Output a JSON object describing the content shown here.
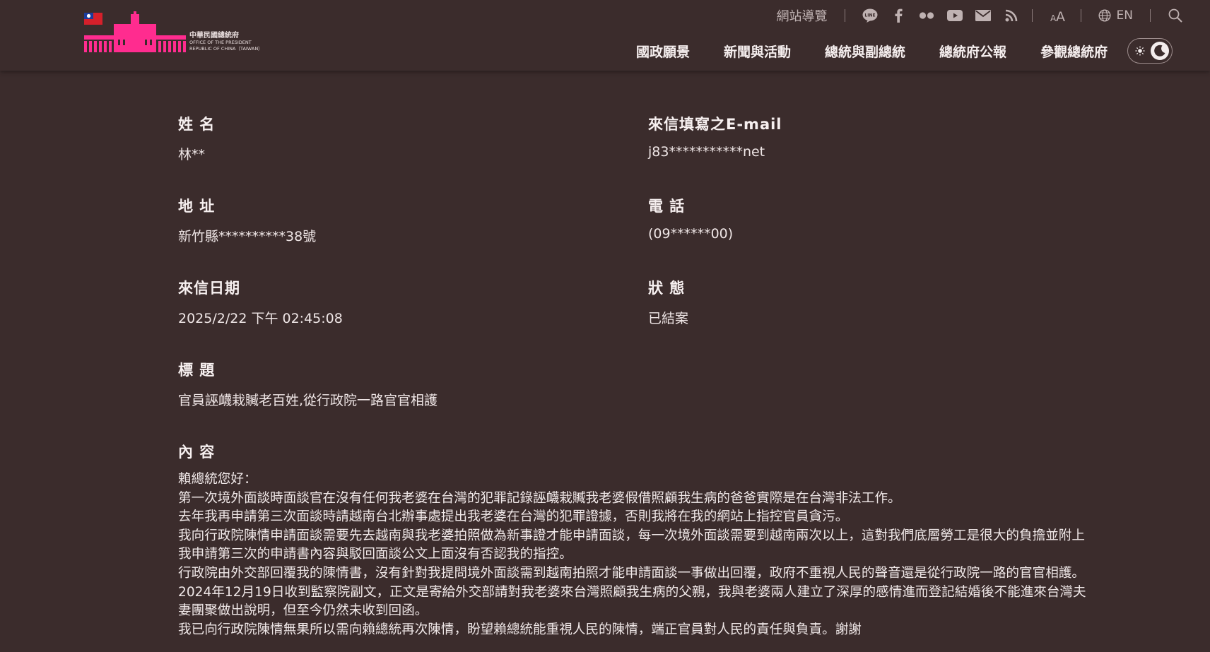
{
  "header": {
    "logo": {
      "name_cn": "中華民國總統府",
      "name_en_line1": "OFFICE OF THE PRESIDENT",
      "name_en_line2": "REPUBLIC OF CHINA（TAIWAN）",
      "brand_color": "#ff2c8f"
    },
    "utility": {
      "sitemap_label": "網站導覽",
      "social_icons": [
        "line-icon",
        "facebook-icon",
        "flickr-icon",
        "youtube-icon",
        "mail-icon",
        "rss-icon"
      ],
      "font_size_icon": "font-size-icon",
      "lang_label": "EN",
      "search_icon": "search-icon"
    },
    "nav": {
      "items": [
        {
          "label": "國政願景"
        },
        {
          "label": "新聞與活動"
        },
        {
          "label": "總統與副總統"
        },
        {
          "label": "總統府公報"
        },
        {
          "label": "參觀總統府"
        }
      ]
    },
    "theme_toggle": {
      "light_icon": "sun-icon",
      "dark_icon": "moon-icon",
      "active": "dark"
    }
  },
  "letter": {
    "name": {
      "label": "姓 名",
      "value": "林**"
    },
    "email": {
      "label": "來信填寫之E-mail",
      "value": "j83***********net"
    },
    "address": {
      "label": "地 址",
      "value": "新竹縣**********38號"
    },
    "phone": {
      "label": "電 話",
      "value": "(09******00)"
    },
    "date": {
      "label": "來信日期",
      "value": "2025/2/22 下午 02:45:08"
    },
    "status": {
      "label": "狀 態",
      "value": "已結案"
    },
    "subject": {
      "label": "標 題",
      "value": "官員誣衊栽贓老百姓,從行政院一路官官相護"
    },
    "content": {
      "label": "內 容",
      "paragraphs": [
        "賴總統您好：",
        "第一次境外面談時面談官在沒有任何我老婆在台灣的犯罪記錄誣衊栽贓我老婆假借照顧我生病的爸爸實際是在台灣非法工作。",
        "去年我再申請第三次面談時請越南台北辦事處提出我老婆在台灣的犯罪證據，否則我將在我的網站上指控官員貪污。",
        "我向行政院陳情申請面談需要先去越南與我老婆拍照做為新事證才能申請面談，每一次境外面談需要到越南兩次以上，這對我們底層勞工是很大的負擔並附上我申請第三次的申請書內容與駁回面談公文上面沒有否認我的指控。",
        "行政院由外交部回覆我的陳情書，沒有針對我提問境外面談需到越南拍照才能申請面談一事做出回覆，政府不重視人民的聲音還是從行政院一路的官官相護。",
        "2024年12月19日收到監察院副文，正文是寄給外交部請對我老婆來台灣照顧我生病的父親，我與老婆兩人建立了深厚的感情進而登記結婚後不能進來台灣夫妻團聚做出說明，但至今仍然未收到回函。",
        "我已向行政院陳情無果所以需向賴總統再次陳情，盼望賴總統能重視人民的陳情，端正官員對人民的責任與負責。謝謝"
      ]
    }
  }
}
